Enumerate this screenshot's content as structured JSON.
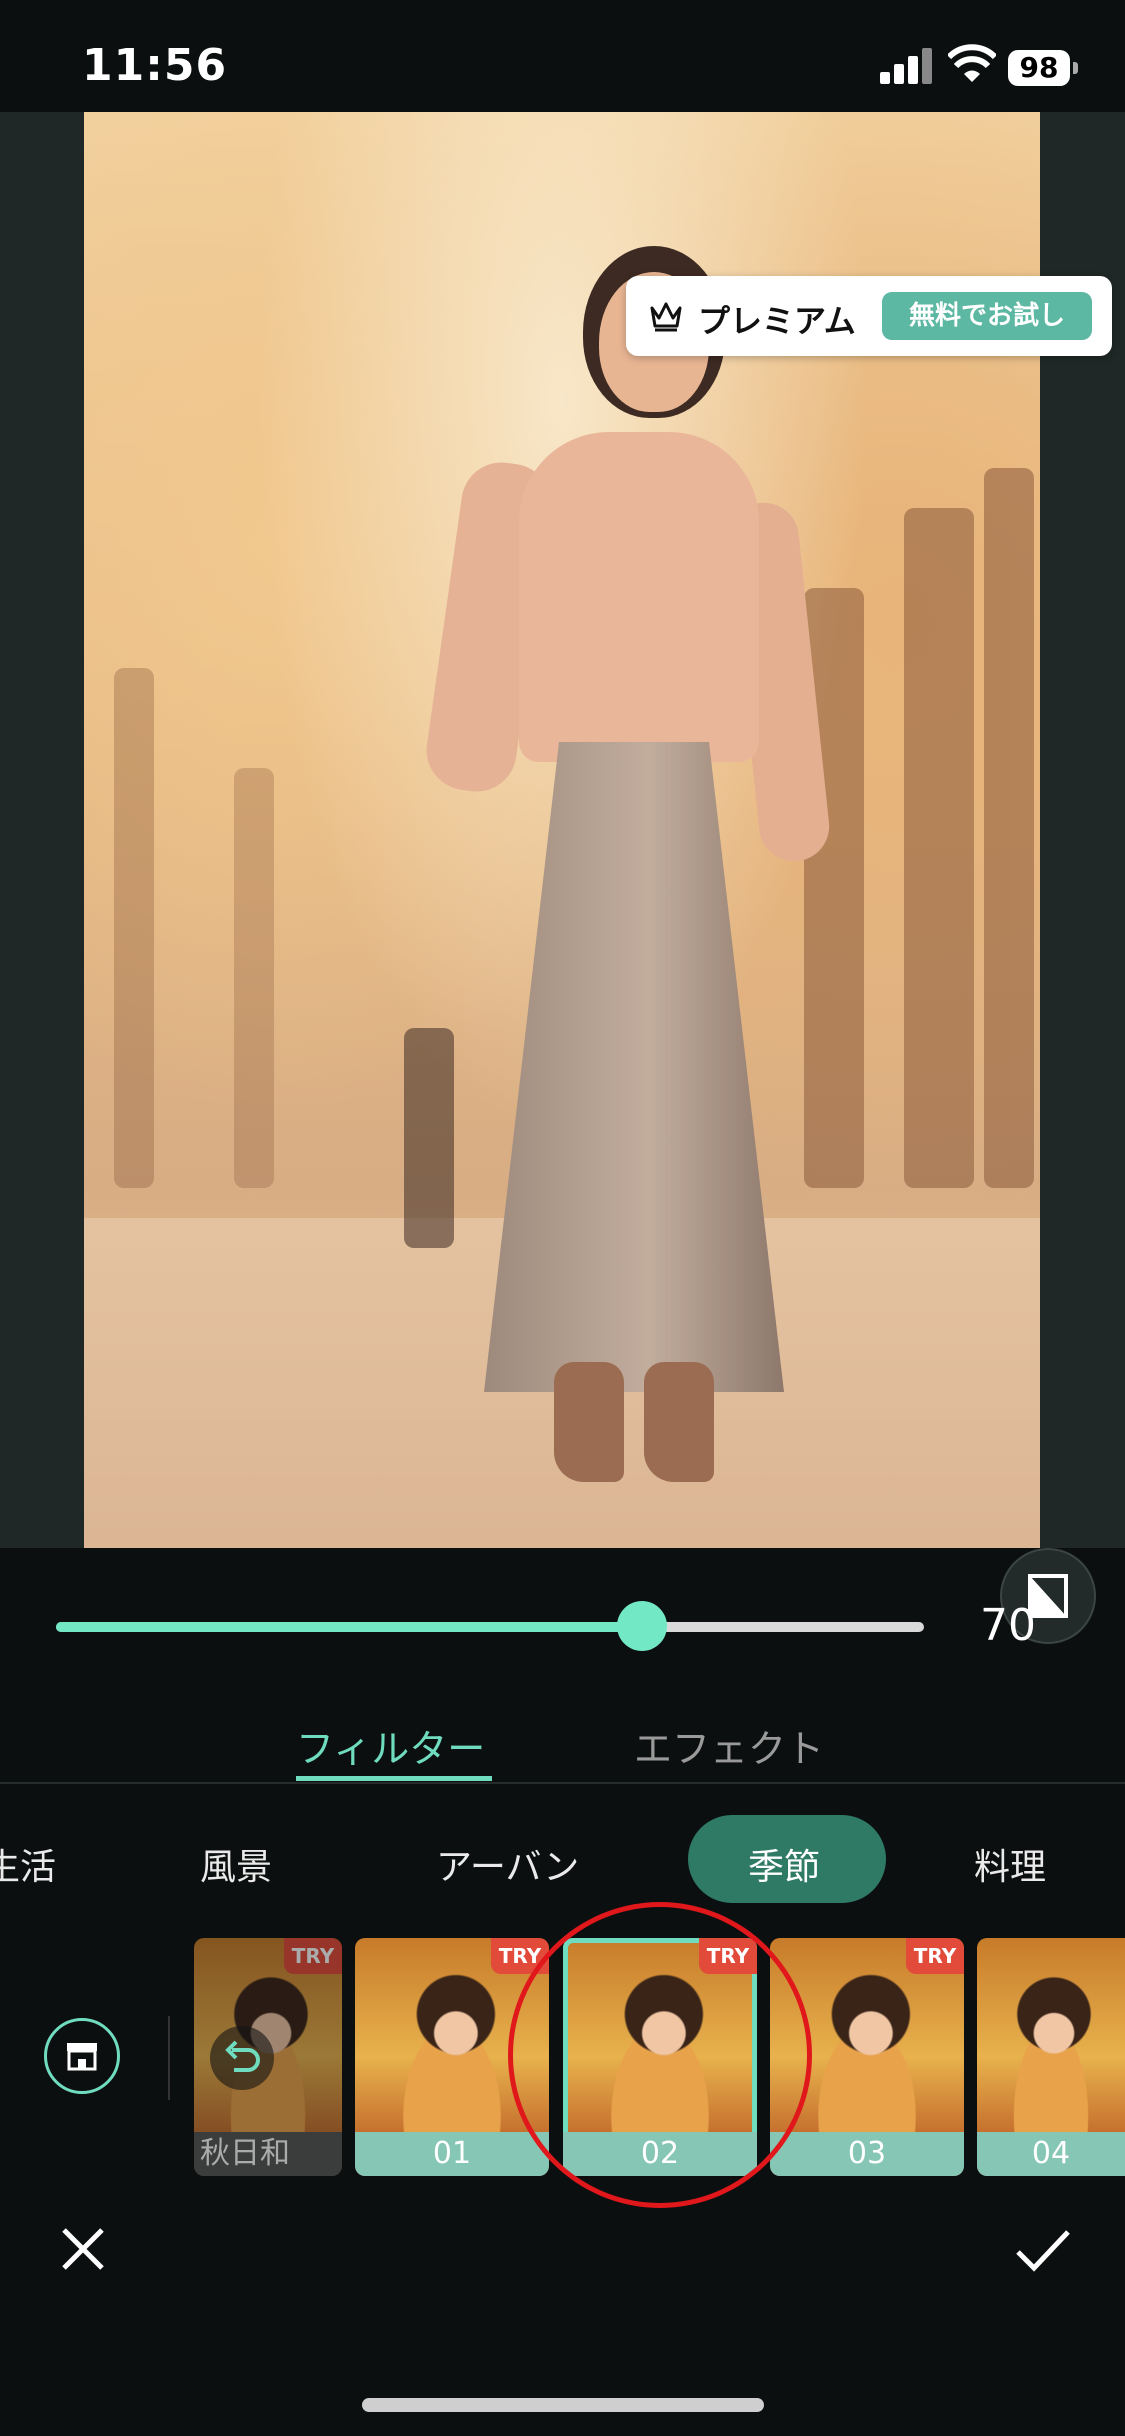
{
  "status_bar": {
    "time": "11:56",
    "battery": "98",
    "icons": [
      "signal-icon",
      "wifi-icon",
      "battery-icon"
    ]
  },
  "premium_banner": {
    "label": "プレミアム",
    "trial_button": "無料でお試し",
    "icon": "crown-icon"
  },
  "intensity": {
    "value": "70",
    "level": 0.7
  },
  "tabs": [
    {
      "label": "フィルター",
      "active": true
    },
    {
      "label": "エフェクト",
      "active": false
    }
  ],
  "categories": [
    {
      "label": "生活",
      "selected": false,
      "partial": true
    },
    {
      "label": "風景",
      "selected": false
    },
    {
      "label": "アーバン",
      "selected": false
    },
    {
      "label": "季節",
      "selected": true
    },
    {
      "label": "料理",
      "selected": false
    }
  ],
  "filters": [
    {
      "label": "秋日和",
      "try": true,
      "partial": true
    },
    {
      "label": "01",
      "try": true
    },
    {
      "label": "02",
      "try": true,
      "selected": true
    },
    {
      "label": "03",
      "try": true
    },
    {
      "label": "04",
      "try": false
    }
  ],
  "try_badge": "TRY",
  "colors": {
    "accent": "#6fdcbf",
    "selected_pill": "#2e7a64",
    "highlight_circle": "#e0171b"
  }
}
